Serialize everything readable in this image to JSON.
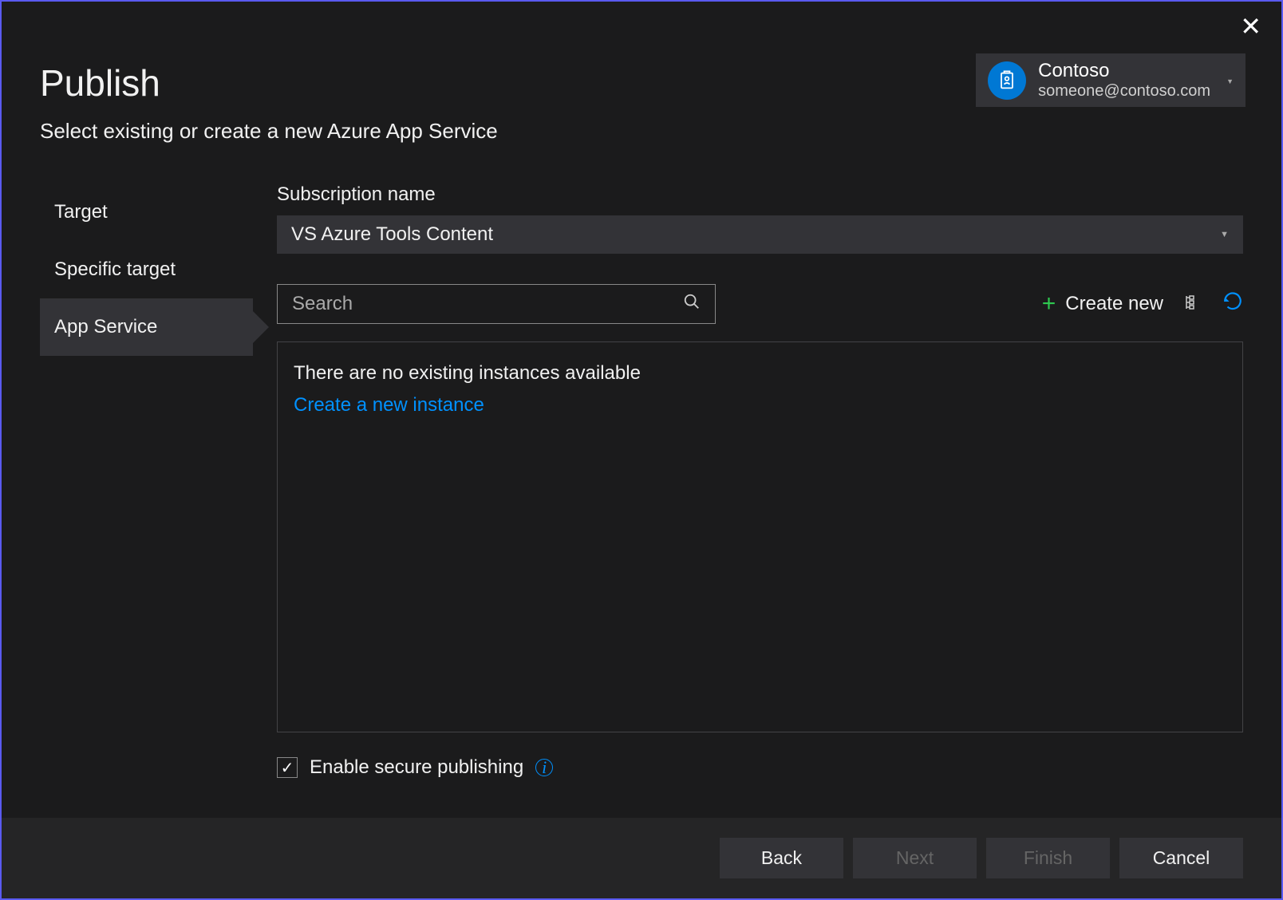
{
  "header": {
    "title": "Publish",
    "subtitle": "Select existing or create a new Azure App Service"
  },
  "account": {
    "name": "Contoso",
    "email": "someone@contoso.com"
  },
  "sidebar": {
    "items": [
      "Target",
      "Specific target",
      "App Service"
    ],
    "activeIndex": 2
  },
  "subscription": {
    "label": "Subscription name",
    "selected": "VS Azure Tools Content"
  },
  "search": {
    "placeholder": "Search"
  },
  "actions": {
    "createNew": "Create new"
  },
  "instances": {
    "emptyMessage": "There are no existing instances available",
    "createLink": "Create a new instance"
  },
  "checkbox": {
    "label": "Enable secure publishing",
    "checked": true
  },
  "footer": {
    "back": "Back",
    "next": "Next",
    "finish": "Finish",
    "cancel": "Cancel"
  }
}
